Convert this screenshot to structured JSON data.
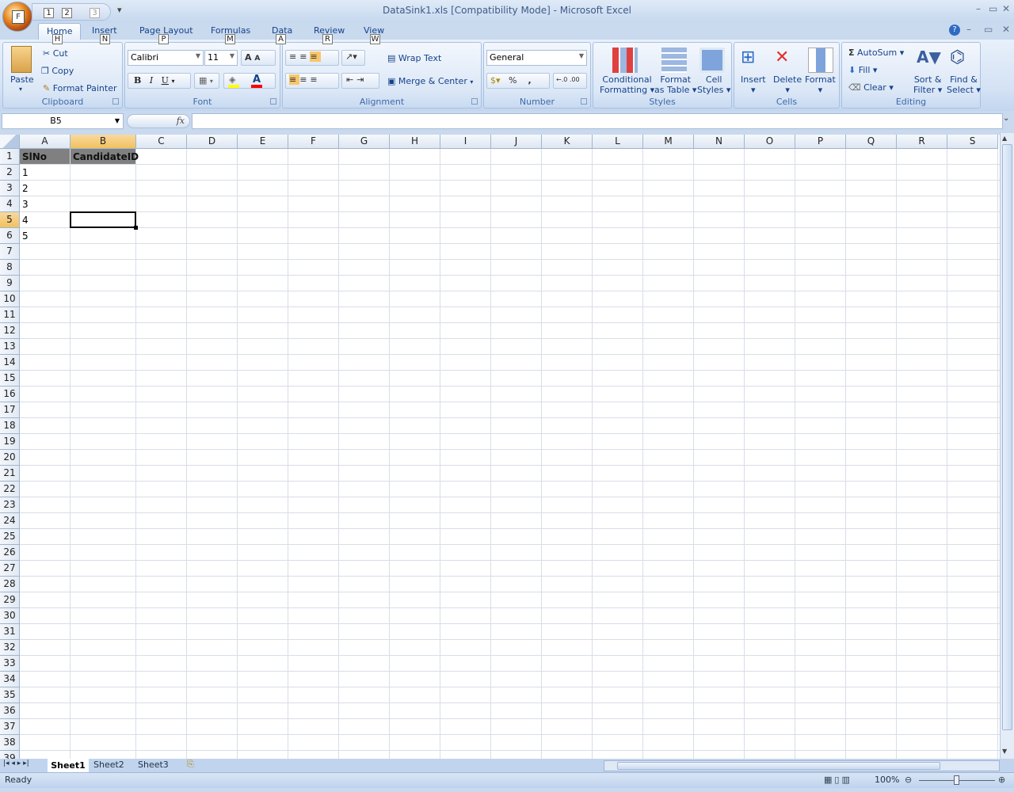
{
  "window": {
    "title": "DataSink1.xls  [Compatibility Mode] - Microsoft Excel",
    "office_key": "F",
    "qat_keys": [
      "1",
      "2",
      "3"
    ]
  },
  "tabs": [
    {
      "label": "Home",
      "key": "H"
    },
    {
      "label": "Insert",
      "key": "N"
    },
    {
      "label": "Page Layout",
      "key": "P"
    },
    {
      "label": "Formulas",
      "key": "M"
    },
    {
      "label": "Data",
      "key": "A"
    },
    {
      "label": "Review",
      "key": "R"
    },
    {
      "label": "View",
      "key": "W"
    }
  ],
  "ribbon": {
    "clipboard": {
      "label": "Clipboard",
      "paste": "Paste",
      "cut": "Cut",
      "copy": "Copy",
      "format_painter": "Format Painter"
    },
    "font": {
      "label": "Font",
      "font_name": "Calibri",
      "font_size": "11",
      "bold": "B",
      "italic": "I",
      "underline": "U",
      "fill_color": "#ffff00",
      "font_color": "#ff0000"
    },
    "alignment": {
      "label": "Alignment",
      "wrap_text": "Wrap Text",
      "merge_center": "Merge & Center"
    },
    "number": {
      "label": "Number",
      "format": "General",
      "percent": "%",
      "comma": ","
    },
    "styles": {
      "label": "Styles",
      "conditional_1": "Conditional",
      "conditional_2": "Formatting",
      "table_1": "Format",
      "table_2": "as Table",
      "cell_1": "Cell",
      "cell_2": "Styles"
    },
    "cells": {
      "label": "Cells",
      "insert": "Insert",
      "delete": "Delete",
      "format": "Format"
    },
    "editing": {
      "label": "Editing",
      "autosum": "AutoSum",
      "fill": "Fill",
      "clear": "Clear",
      "sort_1": "Sort &",
      "sort_2": "Filter",
      "find_1": "Find &",
      "find_2": "Select"
    }
  },
  "formula_bar": {
    "name_box": "B5",
    "fx": "fx",
    "value": ""
  },
  "sheet": {
    "columns": [
      "A",
      "B",
      "C",
      "D",
      "E",
      "F",
      "G",
      "H",
      "I",
      "J",
      "K",
      "L",
      "M",
      "N",
      "O",
      "P",
      "Q",
      "R",
      "S"
    ],
    "row_count": 39,
    "selected_cell": "B5",
    "header_fill": "#808080",
    "cells": [
      {
        "ref": "A1",
        "value": "SlNo",
        "header": true
      },
      {
        "ref": "B1",
        "value": "CandidateID",
        "header": true
      },
      {
        "ref": "A2",
        "value": "1"
      },
      {
        "ref": "A3",
        "value": "2"
      },
      {
        "ref": "A4",
        "value": "3"
      },
      {
        "ref": "A5",
        "value": "4"
      },
      {
        "ref": "A6",
        "value": "5"
      }
    ]
  },
  "sheet_tabs": [
    "Sheet1",
    "Sheet2",
    "Sheet3"
  ],
  "active_sheet": "Sheet1",
  "status": {
    "text": "Ready",
    "zoom": "100%"
  }
}
